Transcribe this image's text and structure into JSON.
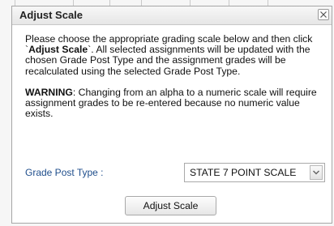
{
  "dialog": {
    "title": "Adjust Scale",
    "close_icon": "close-icon",
    "instructions": {
      "part1": "Please choose the appropriate grading scale below and then click `",
      "bold": "Adjust Scale",
      "part2": "`. All selected assignments will be updated with the chosen Grade Post Type and the assignment grades will be recalculated using the selected Grade Post Type."
    },
    "warning": {
      "label": "WARNING",
      "text": ": Changing from an alpha to a numeric scale will require assignment grades to be re-entered because no numeric value exists."
    },
    "grade_post_type": {
      "label": "Grade Post Type :",
      "selected": "STATE 7 POINT SCALE",
      "arrow_icon": "chevron-down-icon"
    },
    "adjust_button": "Adjust Scale"
  },
  "colors": {
    "label_blue": "#1f4e8c",
    "border": "#a6a6a6"
  }
}
